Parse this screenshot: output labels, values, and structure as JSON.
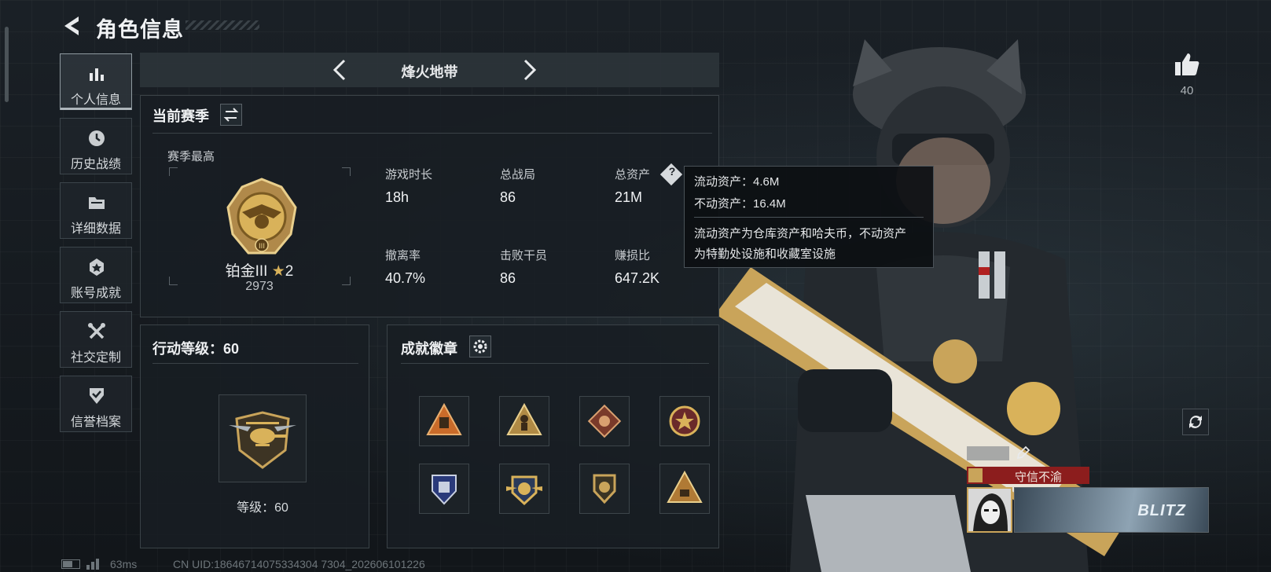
{
  "header": {
    "title": "角色信息"
  },
  "nav": [
    {
      "label": "个人信息",
      "icon": "bar-chart-icon",
      "active": true
    },
    {
      "label": "历史战绩",
      "icon": "clock-icon",
      "active": false
    },
    {
      "label": "详细数据",
      "icon": "folder-icon",
      "active": false
    },
    {
      "label": "账号成就",
      "icon": "achievement-icon",
      "active": false
    },
    {
      "label": "社交定制",
      "icon": "tools-icon",
      "active": false
    },
    {
      "label": "信誉档案",
      "icon": "shield-check-icon",
      "active": false
    }
  ],
  "mode": {
    "name": "烽火地带"
  },
  "season": {
    "title": "当前赛季",
    "best_label": "赛季最高",
    "rank_name": "铂金III",
    "rank_stars": "2",
    "rank_score": "2973",
    "stats": [
      {
        "label": "游戏时长",
        "value": "18h"
      },
      {
        "label": "总战局",
        "value": "86"
      },
      {
        "label": "总资产",
        "value": "21M"
      },
      {
        "label": "撤离率",
        "value": "40.7%"
      },
      {
        "label": "击败干员",
        "value": "86"
      },
      {
        "label": "赚损比",
        "value": "647.2K"
      }
    ]
  },
  "tooltip": {
    "liquid": "流动资产：4.6M",
    "fixed": "不动资产：16.4M",
    "desc_line1": "流动资产为仓库资产和哈夫币，不动资产",
    "desc_line2": "为特勤处设施和收藏室设施"
  },
  "action_level": {
    "title": "行动等级：60",
    "level_text": "等级：60"
  },
  "badges": {
    "title": "成就徽章",
    "items": [
      "badge-triangle-box-icon",
      "badge-triangle-soldier-icon",
      "badge-dragon-icon",
      "badge-star-seal-icon",
      "badge-blue-shield-icon",
      "badge-winged-emblem-icon",
      "badge-lion-shield-icon",
      "badge-triangle-58-icon"
    ]
  },
  "likes": {
    "count": "40"
  },
  "player_card": {
    "tag": "守信不渝",
    "banner_text": "BLITZ"
  },
  "status": {
    "ping": "63ms",
    "uid": "CN UID:18646714075334304 7304_202606101226"
  },
  "colors": {
    "accent_gold": "#d9b25a",
    "tag_red": "#8c1d1d",
    "panel_border": "#3a4247"
  }
}
